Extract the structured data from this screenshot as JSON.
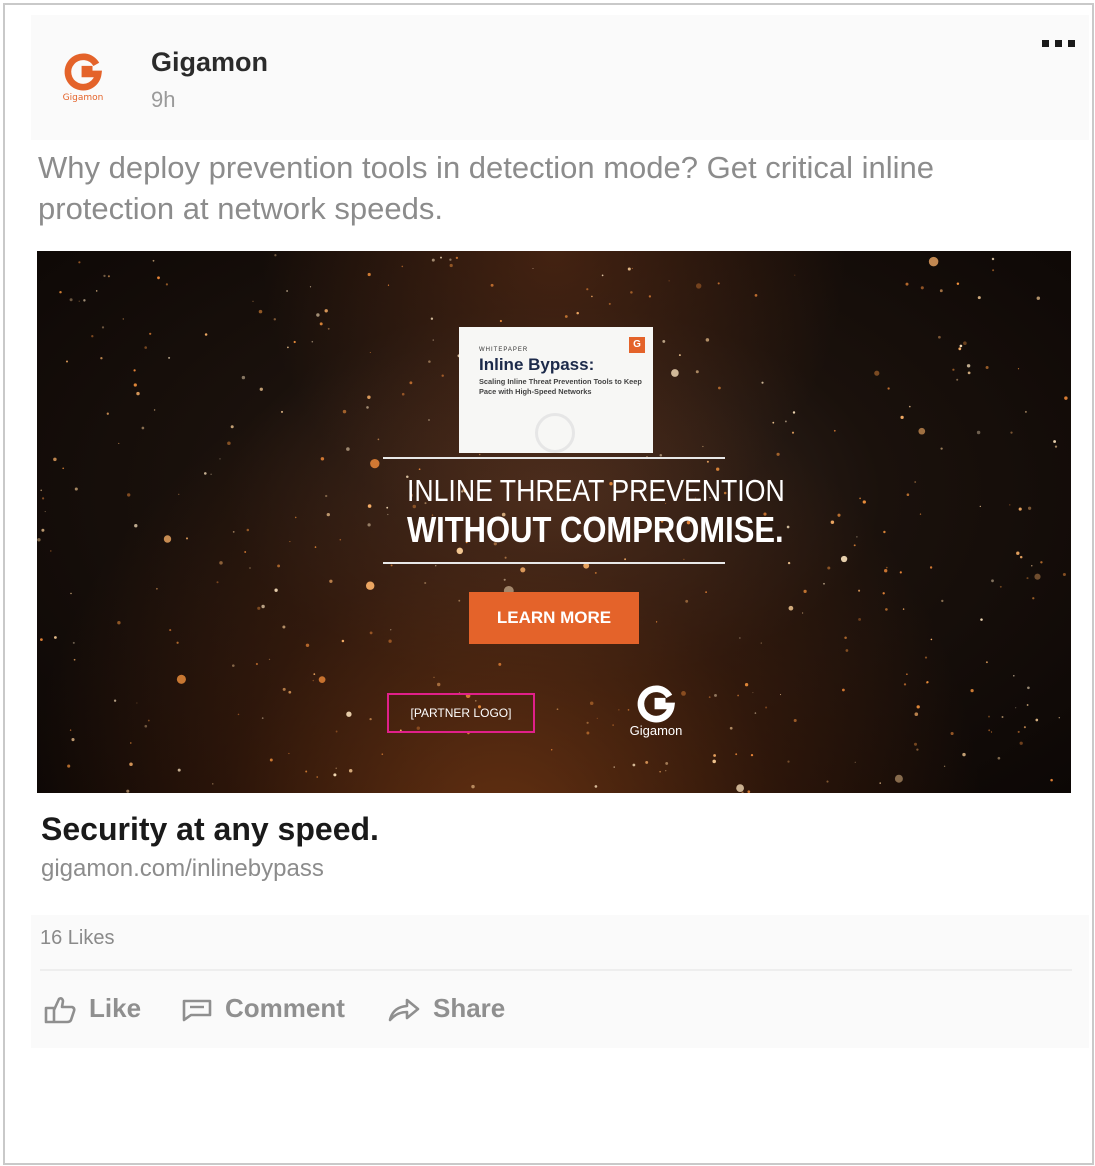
{
  "post": {
    "author": "Gigamon",
    "avatar_text": "Gigamon",
    "time": "9h",
    "text": "Why deploy prevention tools in detection mode? Get critical inline protection at network speeds."
  },
  "ad": {
    "whitepaper_label": "WHITEPAPER",
    "whitepaper_title": "Inline Bypass:",
    "whitepaper_subtitle": "Scaling Inline Threat Prevention Tools to Keep Pace with High-Speed Networks",
    "headline_line1": "INLINE THREAT PREVENTION",
    "headline_line2": "WITHOUT COMPROMISE.",
    "cta_label": "LEARN MORE",
    "partner_logo_placeholder": "[PARTNER LOGO]",
    "brand_logo_text": "Gigamon"
  },
  "link": {
    "headline": "Security at any speed.",
    "url": "gigamon.com/inlinebypass"
  },
  "social": {
    "likes": "16 Likes",
    "actions": [
      {
        "label": "Like",
        "icon": "thumbs-up-icon"
      },
      {
        "label": "Comment",
        "icon": "comment-icon"
      },
      {
        "label": "Share",
        "icon": "share-icon"
      }
    ]
  },
  "colors": {
    "brand_orange": "#e4632a",
    "partner_border": "#e0208a",
    "text_gray": "#8c8c8c"
  }
}
